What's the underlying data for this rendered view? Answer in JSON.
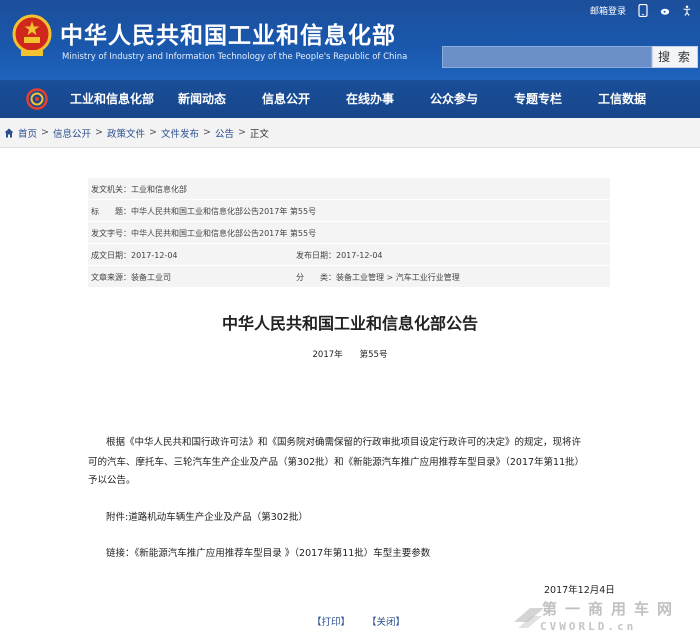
{
  "header": {
    "title": "中华人民共和国工业和信息化部",
    "subtitle": "Ministry of Industry and Information Technology of the People's Republic of China",
    "top_links": [
      "邮箱登录"
    ],
    "search_button": "搜 索",
    "emblem_icon": "national-emblem-icon",
    "colors": {
      "header_blue": "#1a58ad",
      "nav_blue": "#17468b",
      "emblem_red": "#d0271d",
      "gold": "#f2c230"
    }
  },
  "nav": {
    "logo_icon": "miit-logo-icon",
    "items": [
      "工业和信息化部",
      "新闻动态",
      "信息公开",
      "在线办事",
      "公众参与",
      "专题专栏",
      "工信数据"
    ]
  },
  "breadcrumb": {
    "items": [
      "首页",
      "信息公开",
      "政策文件",
      "文件发布",
      "公告"
    ],
    "current": "正文"
  },
  "info": {
    "issuer_label": "发文机关：",
    "issuer": "工业和信息化部",
    "title_label": "标　　题：",
    "title": "中华人民共和国工业和信息化部公告2017年 第55号",
    "doc_no_label": "发文字号：",
    "doc_no": "中华人民共和国工业和信息化部公告2017年 第55号",
    "created_label": "成文日期：",
    "created": "2017-12-04",
    "published_label": "发布日期：",
    "published": "2017-12-04",
    "source_label": "文章来源：",
    "source": "装备工业司",
    "category_label": "分　　类：",
    "category": "装备工业管理 > 汽车工业行业管理"
  },
  "document": {
    "title": "中华人民共和国工业和信息化部公告",
    "number": "2017年　　第55号",
    "para1_line1": "根据《中华人民共和国行政许可法》和《国务院对确需保留的行政审批项目设定行政许可的决定》的规定，现将许",
    "para1_line2": "可的汽车、摩托车、三轮汽车生产企业及产品（第302批）和《新能源汽车推广应用推荐车型目录》（2017年第11批）",
    "para1_line3": "予以公告。",
    "attachment": "附件:道路机动车辆生产企业及产品（第302批）",
    "link": "链接：《新能源汽车推广应用推荐车型目录 》（2017年第11批）车型主要参数",
    "date": "2017年12月4日",
    "print_button": "【打印】",
    "close_button": "【关闭】"
  },
  "watermark": {
    "text": "第一商用车网",
    "sub": "CVWORLD.cn"
  }
}
